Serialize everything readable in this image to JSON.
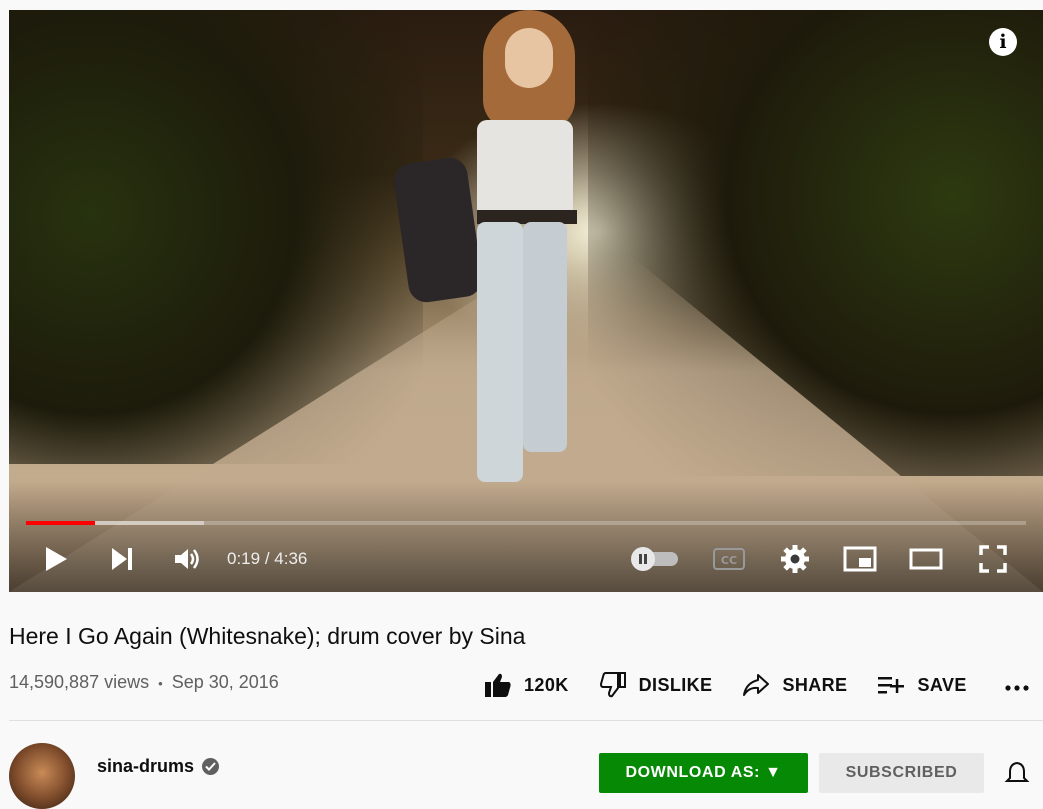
{
  "player": {
    "time_current": "0:19",
    "time_separator": " / ",
    "time_total": "4:36",
    "played_fraction": 0.069,
    "buffered_fraction": 0.178,
    "autoplay_on": false,
    "icons": [
      "info-icon",
      "play-icon",
      "next-icon",
      "volume-icon",
      "autoplay-toggle",
      "captions-icon",
      "settings-icon",
      "miniplayer-icon",
      "theater-icon",
      "fullscreen-icon"
    ],
    "colors": {
      "progress": "#ff0000"
    }
  },
  "video": {
    "title": "Here I Go Again (Whitesnake); drum cover by Sina",
    "views": "14,590,887 views",
    "separator": "•",
    "date": "Sep 30, 2016"
  },
  "actions": {
    "like_count": "120K",
    "dislike_label": "DISLIKE",
    "share_label": "SHARE",
    "save_label": "SAVE"
  },
  "channel": {
    "name": "sina-drums",
    "verified": true
  },
  "buttons": {
    "download_label": "DOWNLOAD AS: ▼",
    "subscribed_label": "SUBSCRIBED",
    "download_color": "#068a06"
  }
}
